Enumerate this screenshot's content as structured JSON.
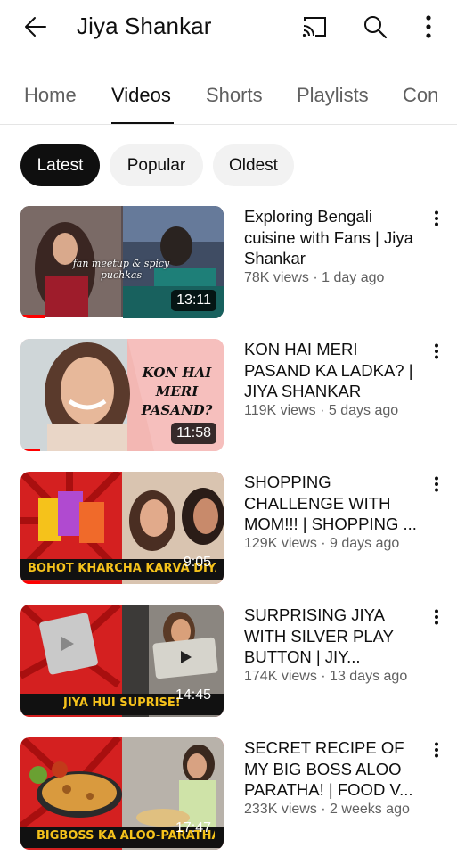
{
  "header": {
    "title": "Jiya Shankar",
    "back_icon": "arrow-left-icon",
    "cast_icon": "cast-icon",
    "search_icon": "search-icon",
    "more_icon": "more-vert-icon"
  },
  "tabs": [
    {
      "label": "Home",
      "active": false
    },
    {
      "label": "Videos",
      "active": true
    },
    {
      "label": "Shorts",
      "active": false
    },
    {
      "label": "Playlists",
      "active": false
    },
    {
      "label": "Con",
      "active": false
    }
  ],
  "chips": [
    {
      "label": "Latest",
      "active": true
    },
    {
      "label": "Popular",
      "active": false
    },
    {
      "label": "Oldest",
      "active": false
    }
  ],
  "videos": [
    {
      "title": "Exploring Bengali cuisine with Fans | Jiya Shankar",
      "stats": "78K views · 1 day ago",
      "duration": "13:11",
      "watched_fraction": 0.12,
      "thumb_caption": "fan meetup & spicy puchkas"
    },
    {
      "title": "KON HAI MERI PASAND KA LADKA? | JIYA SHANKAR",
      "stats": "119K views · 5 days ago",
      "duration": "11:58",
      "watched_fraction": 0.1,
      "thumb_caption": "KON HAI MERI PASAND?"
    },
    {
      "title": "SHOPPING CHALLENGE WITH MOM!!! | SHOPPING ...",
      "stats": "129K views · 9 days ago",
      "duration": "9:05",
      "watched_fraction": 0.1,
      "thumb_caption": "BOHOT KHARCHA KARVA DIYA"
    },
    {
      "title": "SURPRISING JIYA WITH SILVER PLAY BUTTON | JIY...",
      "stats": "174K views · 13 days ago",
      "duration": "14:45",
      "watched_fraction": 0,
      "thumb_caption": "JIYA HUI SUPRISE!"
    },
    {
      "title": "SECRET RECIPE OF MY BIG BOSS ALOO PARATHA! | FOOD V...",
      "stats": "233K views · 2 weeks ago",
      "duration": "17:47",
      "watched_fraction": 0,
      "thumb_caption": "BIGBOSS KA ALOO-PARATHA"
    }
  ],
  "colors": {
    "accent": "#ff0000",
    "text": "#0f0f0f",
    "secondary_text": "#606060",
    "chip_bg": "#f2f2f2"
  }
}
